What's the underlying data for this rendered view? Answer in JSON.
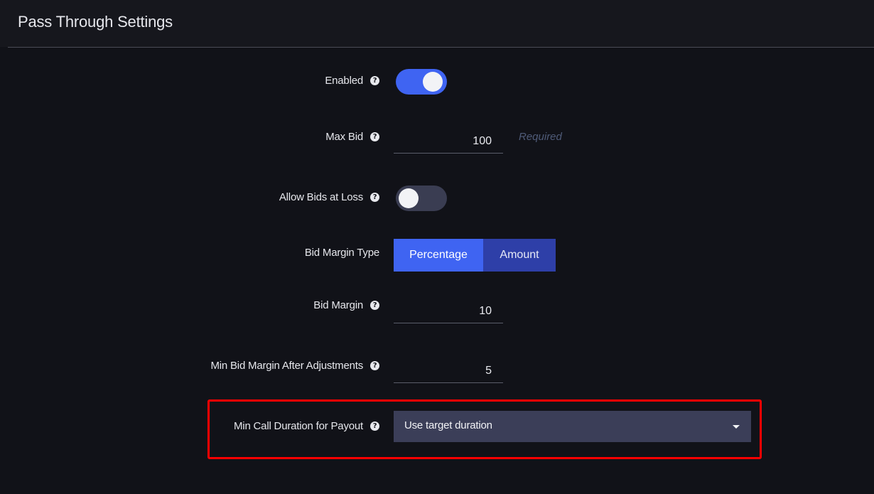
{
  "section": {
    "title": "Pass Through Settings"
  },
  "fields": {
    "enabled": {
      "label": "Enabled",
      "state": "on"
    },
    "max_bid": {
      "label": "Max Bid",
      "value": "100",
      "hint": "Required"
    },
    "allow_bids_at_loss": {
      "label": "Allow Bids at Loss",
      "state": "off"
    },
    "bid_margin_type": {
      "label": "Bid Margin Type",
      "options": [
        "Percentage",
        "Amount"
      ],
      "selected": "Percentage"
    },
    "bid_margin": {
      "label": "Bid Margin",
      "value": "10"
    },
    "min_bid_margin_after_adjustments": {
      "label": "Min Bid Margin After Adjustments",
      "value": "5"
    },
    "min_call_duration_for_payout": {
      "label": "Min Call Duration for Payout",
      "selected": "Use target duration"
    }
  },
  "icons": {
    "help": "?"
  },
  "colors": {
    "background": "#111218",
    "accent": "#3f64f2",
    "highlight": "#ff0000"
  }
}
